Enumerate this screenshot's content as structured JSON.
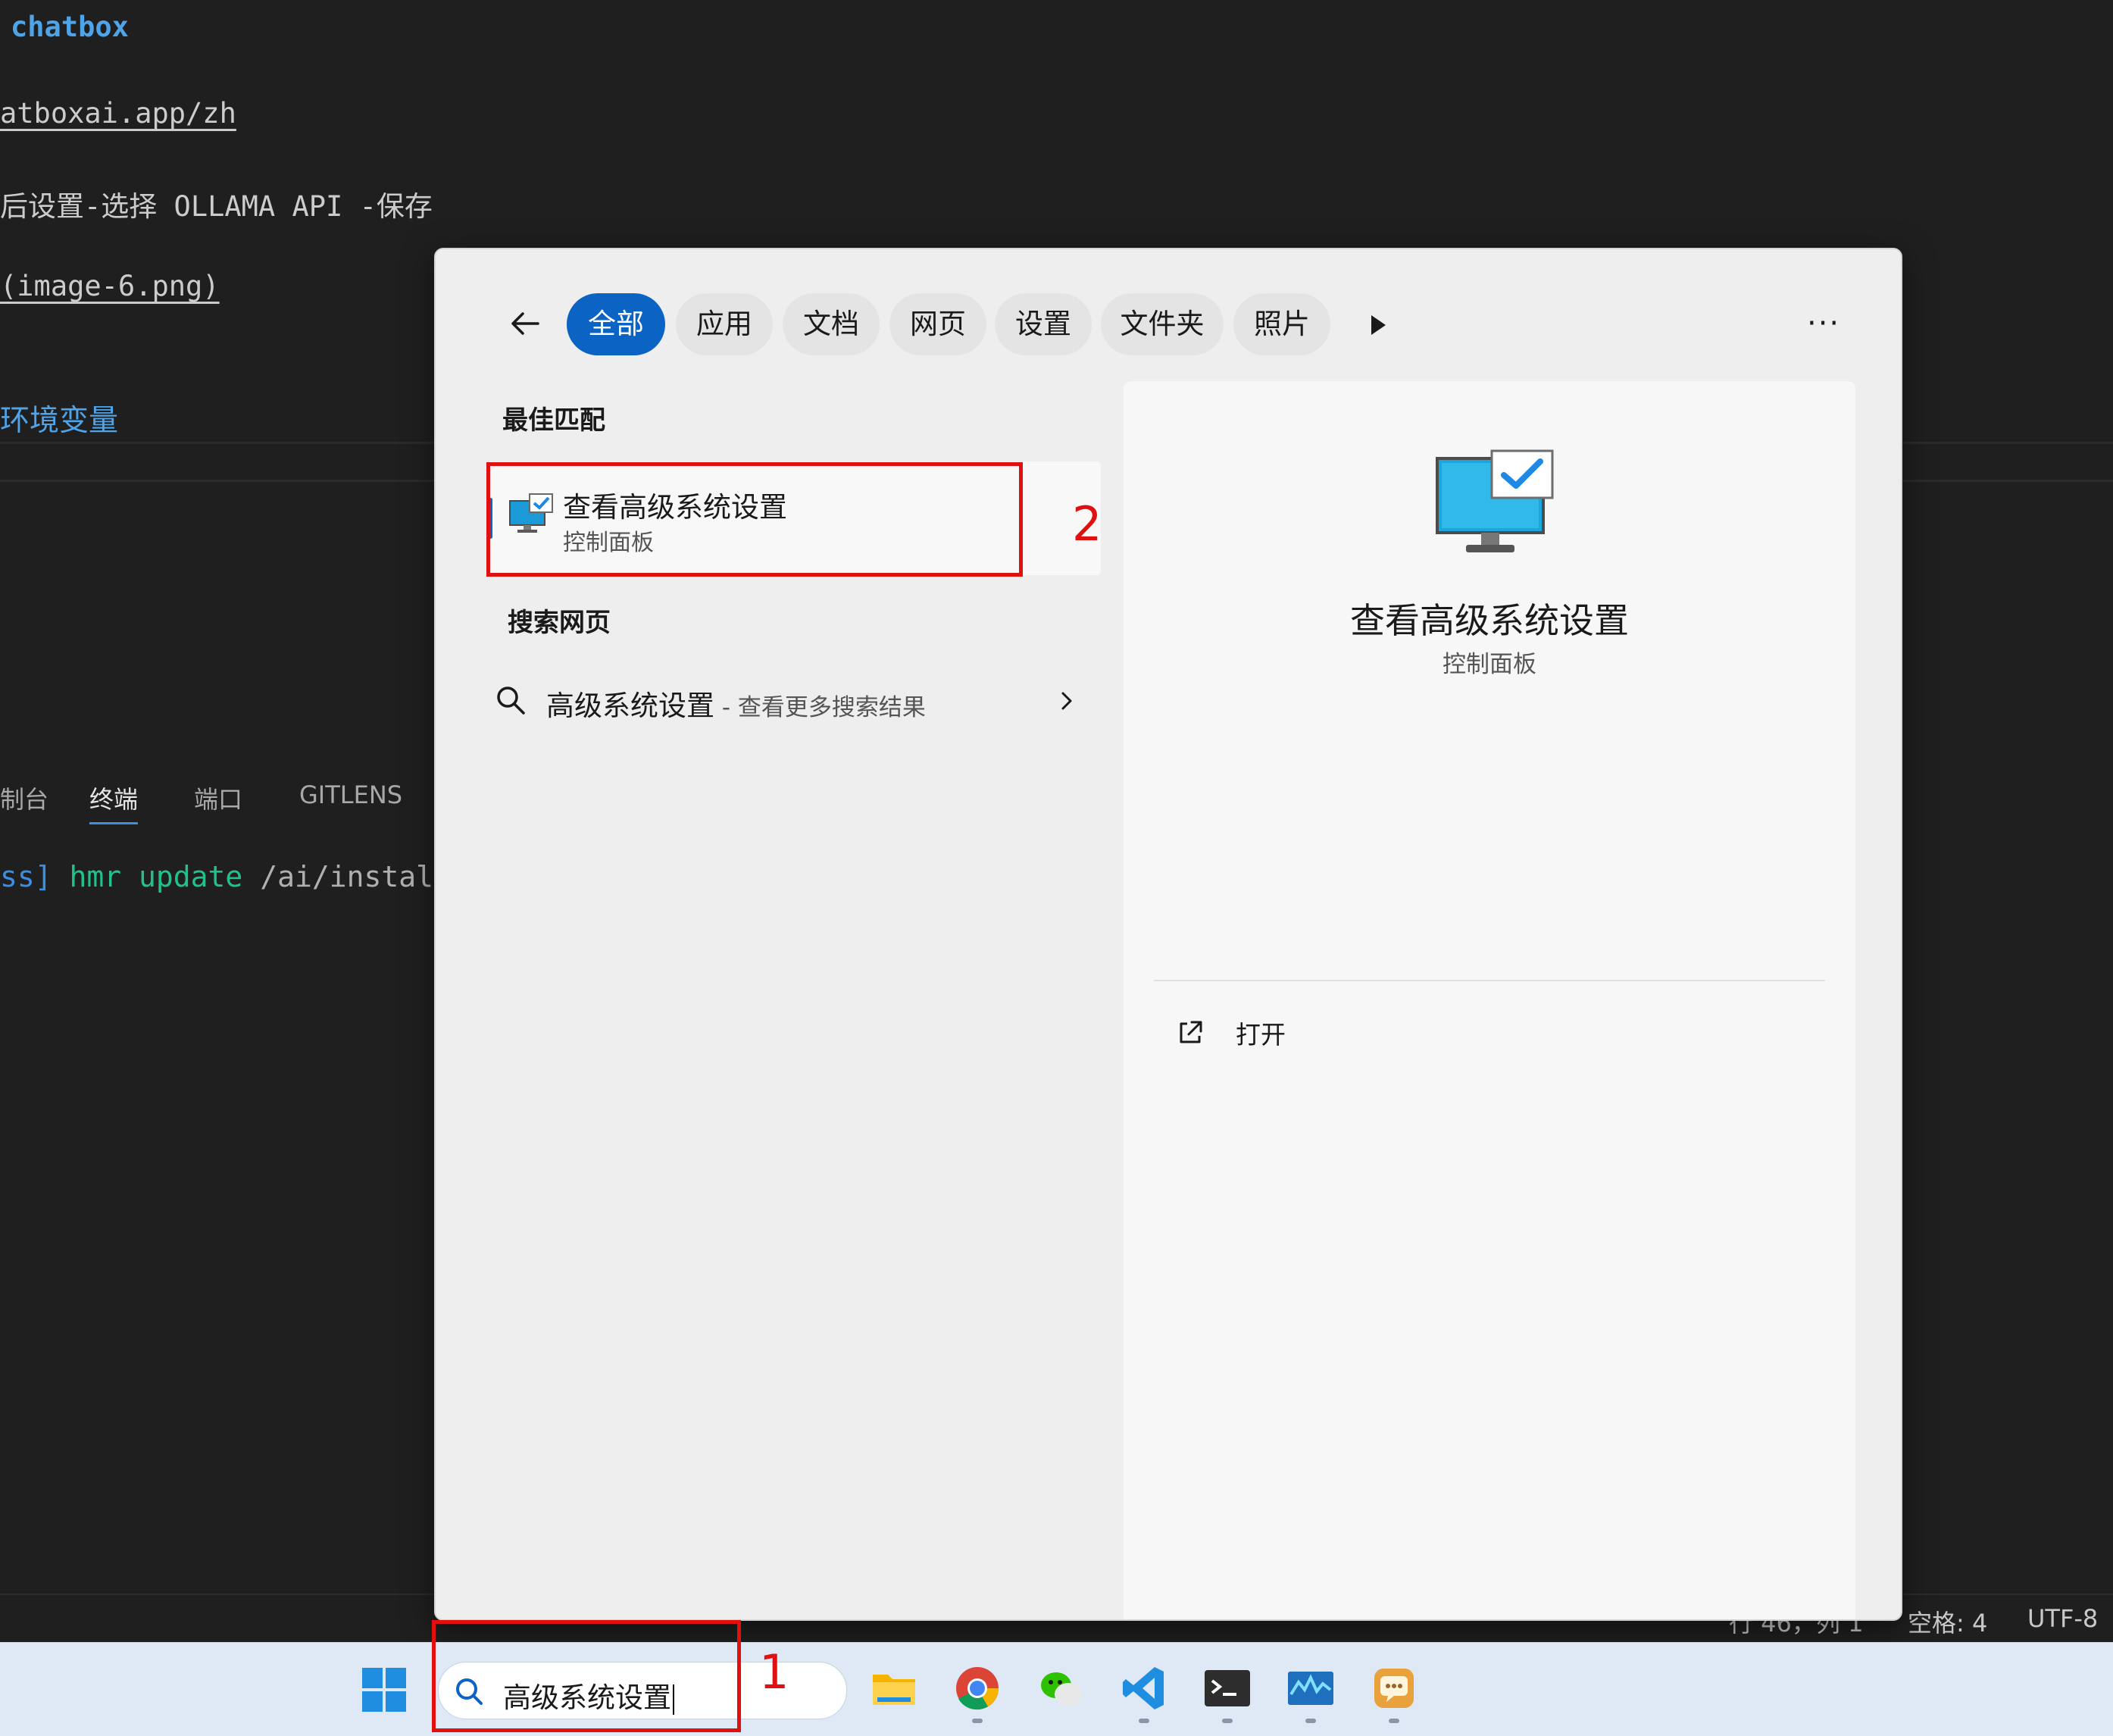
{
  "editor": {
    "lines": [
      "chatbox",
      "atboxai.app/zh",
      "后设置-选择 OLLAMA API -保存",
      "(image-6.png)",
      "环境变量"
    ],
    "panel_tabs": [
      "制台",
      "终端",
      "端口",
      "GITLENS"
    ],
    "terminal": {
      "prefix": "ss]",
      "cmd": "hmr update",
      "path": "/ai/instal"
    },
    "status": {
      "pos": "行 46，列 1",
      "indent": "空格: 4",
      "encoding": "UTF-8"
    }
  },
  "taskbar": {
    "search_value": "高级系统设置",
    "apps": [
      "file-explorer",
      "chrome",
      "wechat",
      "vscode",
      "terminal",
      "resource-monitor",
      "chat-app"
    ]
  },
  "search_popup": {
    "filters": [
      "全部",
      "应用",
      "文档",
      "网页",
      "设置",
      "文件夹",
      "照片"
    ],
    "active_filter": "全部",
    "more": "···",
    "best_match": {
      "section": "最佳匹配",
      "title": "查看高级系统设置",
      "subtitle": "控制面板"
    },
    "web": {
      "section": "搜索网页",
      "query": "高级系统设置",
      "hint": " - 查看更多搜索结果"
    },
    "preview": {
      "title": "查看高级系统设置",
      "subtitle": "控制面板",
      "open_label": "打开"
    }
  },
  "annotations": {
    "step1": "1",
    "step2": "2"
  },
  "colors": {
    "accent": "#0b63c4",
    "annotation": "#e01010",
    "link": "#4fa3e8"
  }
}
